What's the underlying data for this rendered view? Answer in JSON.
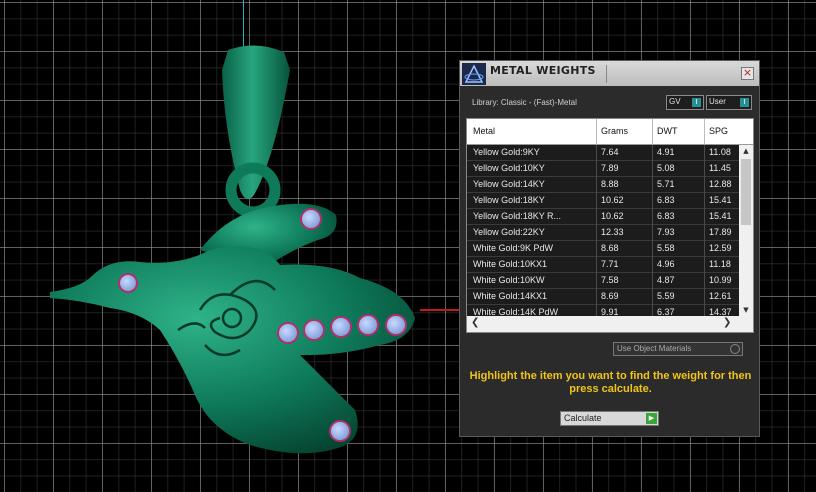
{
  "panel": {
    "title": "METAL WEIGHTS",
    "close": "×",
    "library_label": "Library: Classic - (Fast)-Metal",
    "gv_label": "GV",
    "user_label": "User",
    "toggle_mark": "I",
    "columns": [
      "Metal",
      "Grams",
      "DWT",
      "SPG"
    ],
    "rows": [
      {
        "metal": "Yellow Gold:9KY",
        "grams": "7.64",
        "dwt": "4.91",
        "spg": "11.08"
      },
      {
        "metal": "Yellow Gold:10KY",
        "grams": "7.89",
        "dwt": "5.08",
        "spg": "11.45"
      },
      {
        "metal": "Yellow Gold:14KY",
        "grams": "8.88",
        "dwt": "5.71",
        "spg": "12.88"
      },
      {
        "metal": "Yellow Gold:18KY",
        "grams": "10.62",
        "dwt": "6.83",
        "spg": "15.41"
      },
      {
        "metal": "Yellow Gold:18KY R...",
        "grams": "10.62",
        "dwt": "6.83",
        "spg": "15.41"
      },
      {
        "metal": "Yellow Gold:22KY",
        "grams": "12.33",
        "dwt": "7.93",
        "spg": "17.89"
      },
      {
        "metal": "White Gold:9K PdW",
        "grams": "8.68",
        "dwt": "5.58",
        "spg": "12.59"
      },
      {
        "metal": "White Gold:10KX1",
        "grams": "7.71",
        "dwt": "4.96",
        "spg": "11.18"
      },
      {
        "metal": "White Gold:10KW",
        "grams": "7.58",
        "dwt": "4.87",
        "spg": "10.99"
      },
      {
        "metal": "White Gold:14KX1",
        "grams": "8.69",
        "dwt": "5.59",
        "spg": "12.61"
      },
      {
        "metal": "White Gold:14K PdW",
        "grams": "9.91",
        "dwt": "6.37",
        "spg": "14.37"
      }
    ],
    "use_object_materials_label": "Use Object Materials",
    "instruction": "Highlight the item you want to find the weight for then press calculate.",
    "calculate_label": "Calculate"
  },
  "colors": {
    "model_green": "#0e7a5a",
    "instruction_yellow": "#f0c419",
    "gem_blue": "#8fb0e8"
  }
}
